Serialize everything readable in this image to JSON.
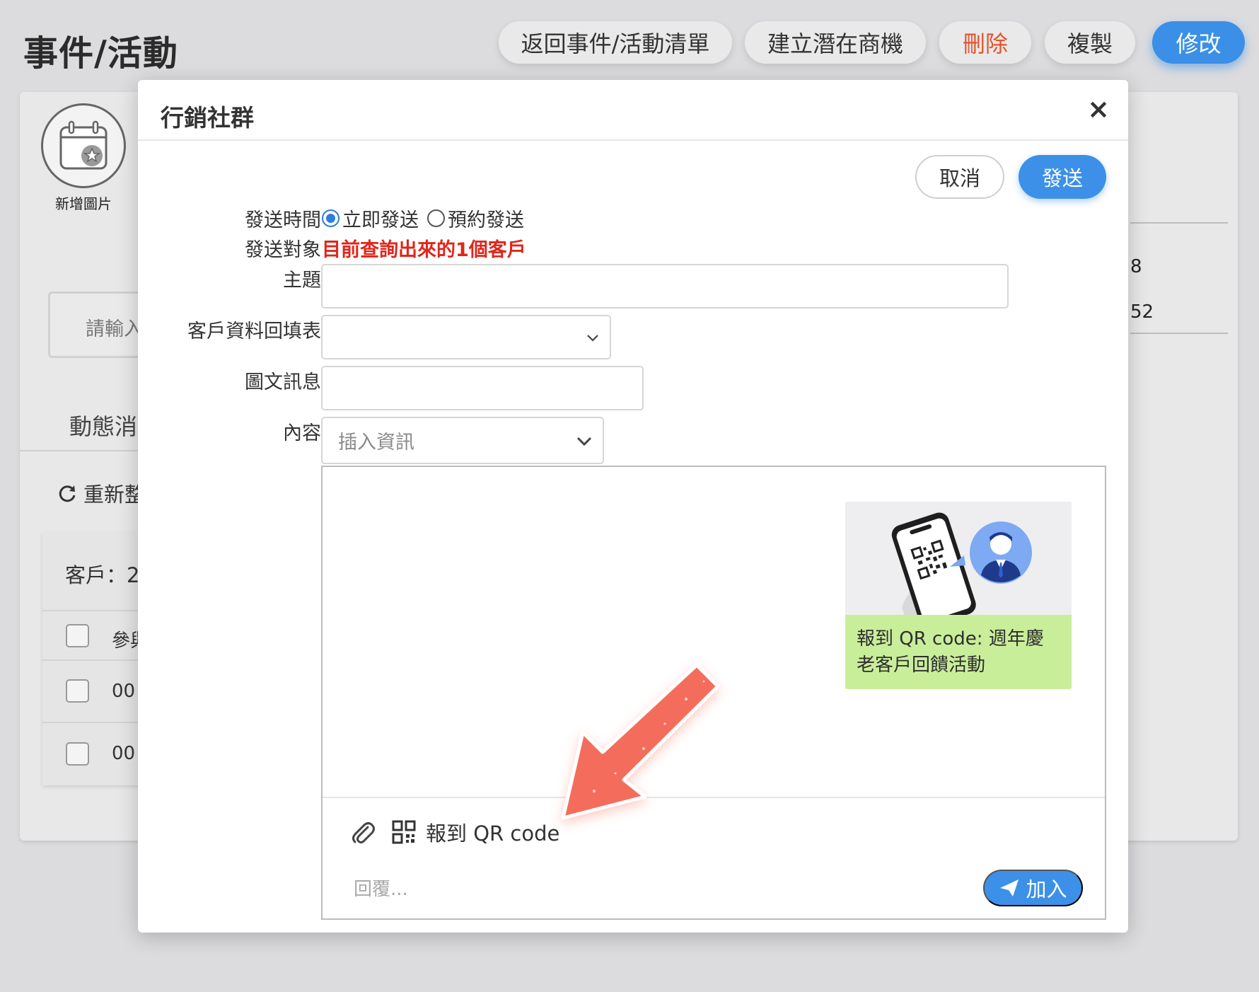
{
  "page": {
    "title": "事件/活動",
    "buttons": {
      "back": "返回事件/活動清單",
      "create_opportunity": "建立潛在商機",
      "delete": "刪除",
      "copy": "複製",
      "edit": "修改"
    }
  },
  "background": {
    "avatar_label": "新增圖片",
    "search_input_partial": "請輸入",
    "tab_partial": "動態消",
    "refresh_partial": "重新整",
    "customer_partial": "客戶：2",
    "header_partial": "參與",
    "row1_partial": "00",
    "row2_partial": "00",
    "right_value_1": "8",
    "right_value_2": "52"
  },
  "modal": {
    "title": "行銷社群",
    "close": "×",
    "cancel_label": "取消",
    "send_label": "發送",
    "fields": {
      "send_time_label": "發送時間",
      "send_now": "立即發送",
      "send_scheduled": "預約發送",
      "send_time_selected": "立即發送",
      "target_label": "發送對象",
      "target_value": "目前查詢出來的1個客戶",
      "subject_label": "主題",
      "subject_value": "",
      "form_label": "客戶資料回填表",
      "form_value": "",
      "image_msg_label": "圖文訊息",
      "image_msg_value": "",
      "content_label": "內容",
      "content_placeholder": "插入資訊"
    },
    "editor": {
      "card_text": "報到 QR code: 週年慶老客戶回饋活動",
      "attachment_label": "報到 QR code",
      "reply_placeholder": "回覆...",
      "add_label": "加入"
    }
  },
  "colors": {
    "primary": "#3c90e8",
    "danger": "#e2532b",
    "target_red": "#e0261b",
    "card_green": "#c9ee9a",
    "arrow": "#f46d5c"
  }
}
